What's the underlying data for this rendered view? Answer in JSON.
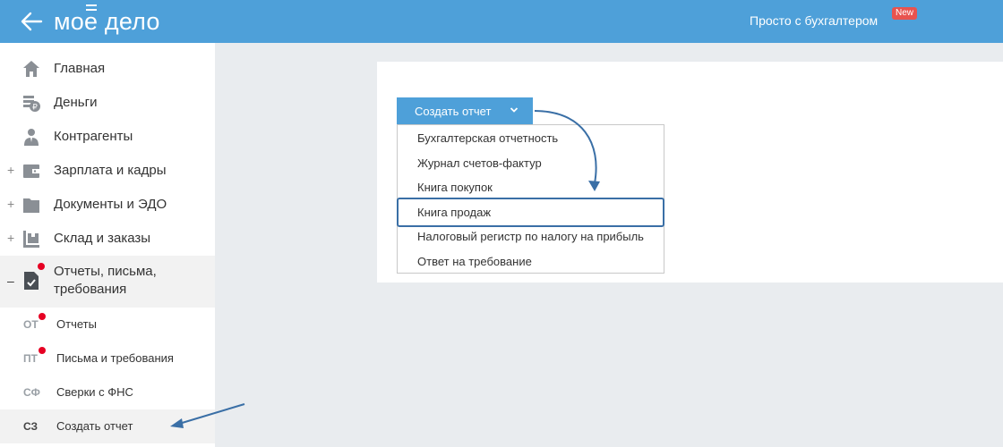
{
  "header": {
    "logo": "моё дело",
    "logo_main": "мо",
    "logo_e": "е",
    "logo_rest": " дело",
    "link": "Просто с бухгалтером",
    "badge": "New",
    "back_icon": "arrow-left-icon"
  },
  "sidebar": {
    "items": [
      {
        "label": "Главная",
        "icon": "home-icon",
        "expandable": false
      },
      {
        "label": "Деньги",
        "icon": "money-icon",
        "expandable": false
      },
      {
        "label": "Контрагенты",
        "icon": "person-icon",
        "expandable": false
      },
      {
        "label": "Зарплата и кадры",
        "icon": "wallet-icon",
        "expandable": true,
        "expand_sign": "+"
      },
      {
        "label": "Документы и ЭДО",
        "icon": "folder-icon",
        "expandable": true,
        "expand_sign": "+"
      },
      {
        "label": "Склад и заказы",
        "icon": "warehouse-icon",
        "expandable": true,
        "expand_sign": "+"
      },
      {
        "label_line1": "Отчеты, письма,",
        "label_line2": "требования",
        "icon": "report-check-icon",
        "expandable": true,
        "expand_sign": "–",
        "has_notification": true
      }
    ],
    "sub_items": [
      {
        "abbr": "ОТ",
        "label": "Отчеты",
        "has_notification": true
      },
      {
        "abbr": "ПТ",
        "label": "Письма и требования",
        "has_notification": true
      },
      {
        "abbr": "СФ",
        "label": "Сверки с ФНС",
        "has_notification": false
      },
      {
        "abbr": "СЗ",
        "label": "Создать отчет",
        "has_notification": false
      }
    ]
  },
  "main": {
    "create_button": "Создать отчет",
    "dropdown": [
      "Бухгалтерская отчетность",
      "Журнал счетов-фактур",
      "Книга покупок",
      "Книга продаж",
      "Налоговый регистр по налогу на прибыль",
      "Ответ на требование"
    ],
    "highlighted_index": 3
  },
  "colors": {
    "header": "#4ea0d9",
    "badge": "#e8534f",
    "notification": "#e60023",
    "annotation": "#3a6fa6"
  }
}
